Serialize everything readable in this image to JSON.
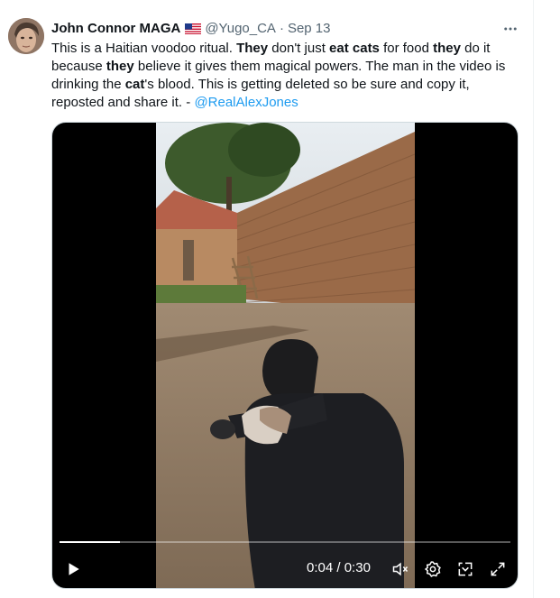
{
  "tweet": {
    "display_name": "John Connor MAGA",
    "flag_icon": "us-flag-icon",
    "handle": "@Yugo_CA",
    "separator": "·",
    "date": "Sep 13",
    "more_icon": "more-horizontal-icon",
    "text_segments": [
      {
        "t": "This is a Haitian voodoo ritual. ",
        "bold": false
      },
      {
        "t": "They",
        "bold": true
      },
      {
        "t": " don't just ",
        "bold": false
      },
      {
        "t": "eat cats",
        "bold": true
      },
      {
        "t": " for food ",
        "bold": false
      },
      {
        "t": "they",
        "bold": true
      },
      {
        "t": " do it because ",
        "bold": false
      },
      {
        "t": "they",
        "bold": true
      },
      {
        "t": " believe it gives them magical powers. The man in the video is drinking the ",
        "bold": false
      },
      {
        "t": "cat",
        "bold": true
      },
      {
        "t": "'s blood. This is getting deleted so be sure and copy it, reposted and share it. - ",
        "bold": false
      }
    ],
    "mention": "@RealAlexJones"
  },
  "video": {
    "current_time": "0:04",
    "duration": "0:30",
    "time_separator": " / ",
    "progress": 0.133,
    "play_icon": "play-icon",
    "mute_icon": "volume-muted-icon",
    "settings_icon": "settings-gear-icon",
    "pip_icon": "picture-in-picture-icon",
    "fullscreen_icon": "fullscreen-icon"
  },
  "colors": {
    "accent": "#1d9bf0",
    "text": "#0f1419",
    "secondary": "#536471"
  }
}
